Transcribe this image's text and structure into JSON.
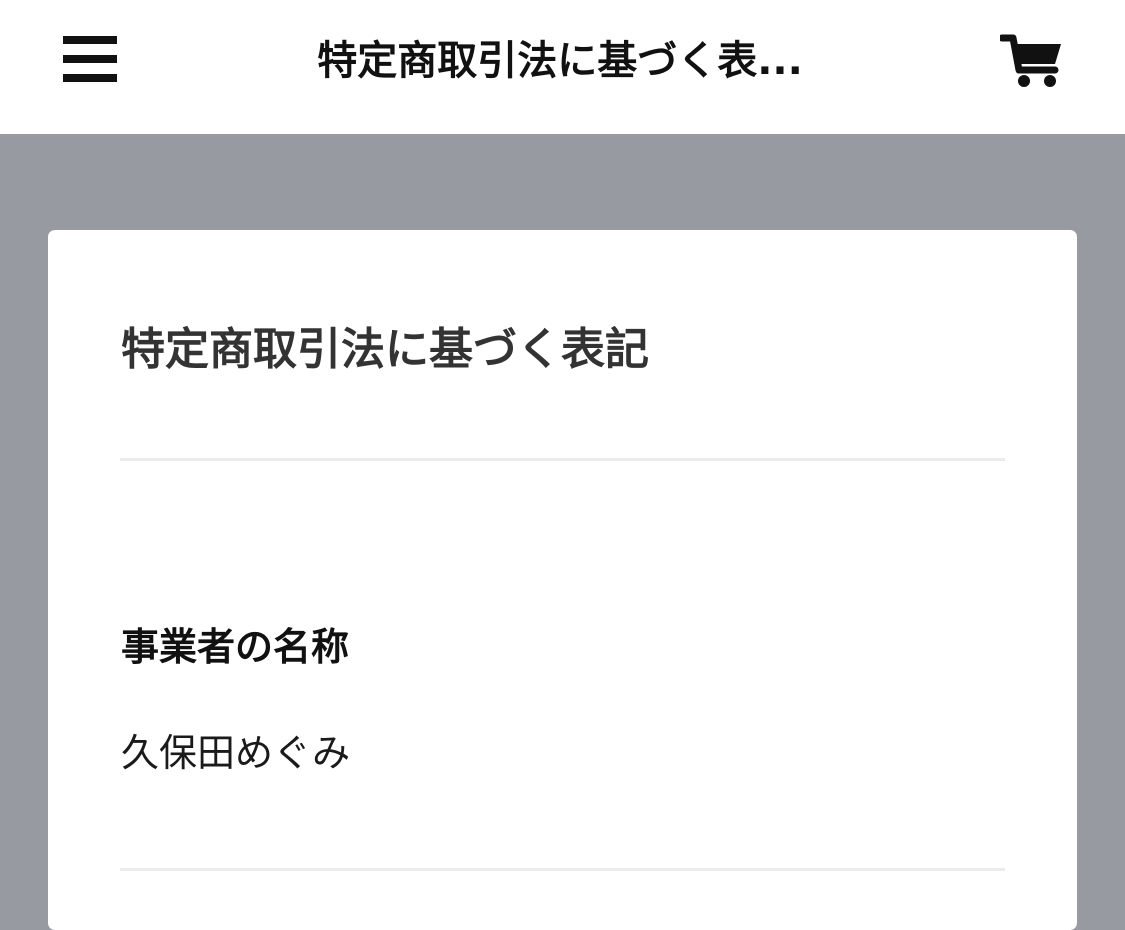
{
  "header": {
    "title": "特定商取引法に基づく表...",
    "menu_icon": "hamburger-menu-icon",
    "cart_icon": "shopping-cart-icon"
  },
  "page": {
    "title": "特定商取引法に基づく表記",
    "sections": [
      {
        "label": "事業者の名称",
        "value": "久保田めぐみ"
      }
    ]
  },
  "colors": {
    "background": "#979ba1",
    "card": "#ffffff",
    "icon": "#111111",
    "text": "#333333",
    "divider": "#ececec"
  }
}
